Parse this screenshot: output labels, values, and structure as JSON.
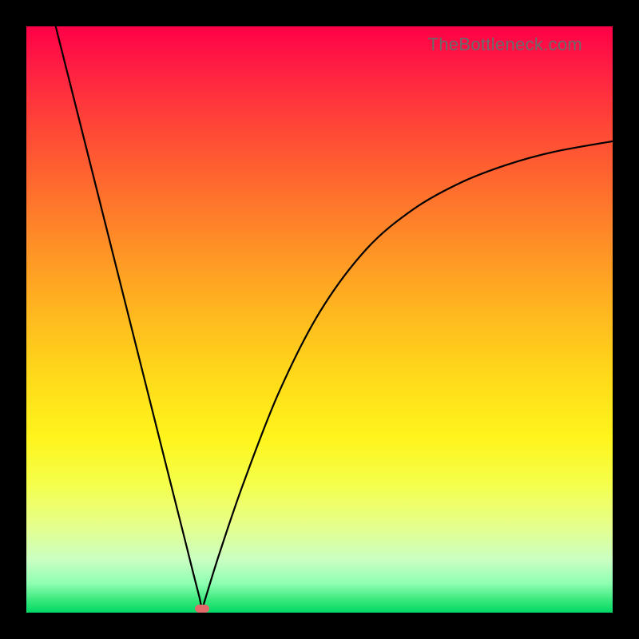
{
  "watermark": "TheBottleneck.com",
  "colors": {
    "frame": "#000000",
    "curve": "#000000",
    "marker": "#e36a6a",
    "gradient_top": "#ff0046",
    "gradient_bottom": "#00d865"
  },
  "chart_data": {
    "type": "line",
    "title": "",
    "xlabel": "",
    "ylabel": "",
    "xlim": [
      0,
      100
    ],
    "ylim": [
      0,
      100
    ],
    "series": [
      {
        "name": "bottleneck-curve",
        "x": [
          5,
          8,
          12,
          16,
          20,
          24,
          27,
          28.5,
          29.5,
          30,
          30.5,
          33,
          37,
          43,
          50,
          58,
          66,
          74,
          82,
          90,
          100
        ],
        "y": [
          100,
          88.1,
          72.2,
          56.3,
          40.4,
          24.5,
          12.6,
          6.6,
          2.7,
          0.7,
          2.3,
          10.3,
          22.0,
          37.4,
          51.2,
          62.0,
          68.8,
          73.3,
          76.4,
          78.6,
          80.4
        ]
      }
    ],
    "annotations": [
      {
        "name": "min-marker",
        "x": 30,
        "y": 0.7
      }
    ]
  }
}
